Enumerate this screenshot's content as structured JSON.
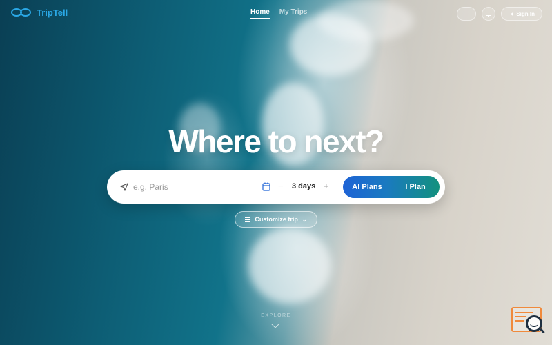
{
  "brand": {
    "name": "TripTell",
    "color": "#2aa8e6"
  },
  "nav": {
    "links": [
      {
        "label": "Home",
        "active": true
      },
      {
        "label": "My Trips",
        "active": false
      }
    ]
  },
  "header_controls": {
    "language_label": "",
    "theme_icon": "monitor-icon",
    "signin_label": "Sign In"
  },
  "hero": {
    "title": "Where to next?"
  },
  "search": {
    "destination_placeholder": "e.g. Paris",
    "destination_value": "",
    "days_label": "3 days",
    "minus_label": "−",
    "plus_label": "+",
    "ai_plans_label": "AI Plans",
    "i_plan_label": "I Plan"
  },
  "customize": {
    "label": "Customize trip"
  },
  "explore": {
    "label": "EXPLORE"
  },
  "colors": {
    "accent_blue": "#1e63d6",
    "accent_teal": "#13917e",
    "widget_orange": "#f08a3c"
  }
}
